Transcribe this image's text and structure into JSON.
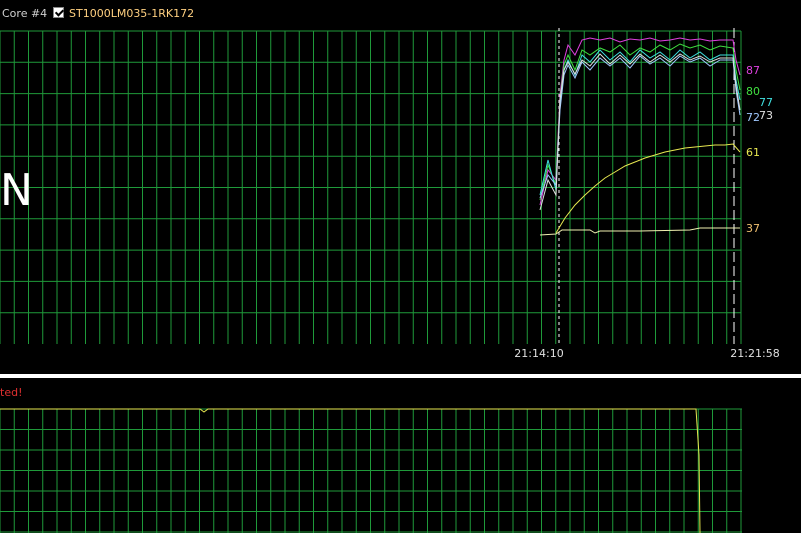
{
  "legend": {
    "core_label": "Core #4",
    "drive_label": "ST1000LM035-1RK172",
    "drive_checked": true
  },
  "overlay_text": "N",
  "status_message": "ted!",
  "colors": {
    "grid": "#1f9a3a",
    "bg": "#000000",
    "magenta": "#e040e0",
    "green": "#40e040",
    "cyan": "#40e0e0",
    "lightblue": "#a0c8ff",
    "white": "#e0e0e0",
    "yellow": "#e8e850",
    "orange": "#f0c070",
    "lightyellow": "#f0f0b0",
    "status_red": "#e03030"
  },
  "chart_data": [
    {
      "type": "line",
      "time_ticks": [
        "21:14:10",
        "21:21:58"
      ],
      "markers": [
        "21:14:10",
        "21:21:58"
      ],
      "end_labels": [
        {
          "text": "87",
          "color": "#e040e0"
        },
        {
          "text": "80",
          "color": "#40e040"
        },
        {
          "text": "77",
          "color": "#40e0e0"
        },
        {
          "text": "72",
          "color": "#a0c8ff"
        },
        {
          "text": "73",
          "color": "#e0e0e0"
        },
        {
          "text": "61",
          "color": "#e8e850"
        },
        {
          "text": "37",
          "color": "#f0c070"
        }
      ],
      "series": [
        {
          "color": "#e040e0",
          "points": [
            [
              540,
              205
            ],
            [
              548,
              170
            ],
            [
              556,
              180
            ],
            [
              560,
              95
            ],
            [
              564,
              60
            ],
            [
              568,
              45
            ],
            [
              575,
              55
            ],
            [
              582,
              40
            ],
            [
              590,
              38
            ],
            [
              600,
              40
            ],
            [
              610,
              38
            ],
            [
              620,
              42
            ],
            [
              630,
              39
            ],
            [
              640,
              40
            ],
            [
              650,
              38
            ],
            [
              660,
              41
            ],
            [
              670,
              40
            ],
            [
              680,
              38
            ],
            [
              690,
              40
            ],
            [
              700,
              39
            ],
            [
              710,
              41
            ],
            [
              720,
              40
            ],
            [
              733,
              40
            ],
            [
              736,
              60
            ],
            [
              740,
              75
            ]
          ]
        },
        {
          "color": "#40e040",
          "points": [
            [
              540,
              200
            ],
            [
              548,
              165
            ],
            [
              556,
              185
            ],
            [
              560,
              100
            ],
            [
              564,
              65
            ],
            [
              568,
              55
            ],
            [
              575,
              70
            ],
            [
              582,
              50
            ],
            [
              590,
              55
            ],
            [
              600,
              48
            ],
            [
              610,
              52
            ],
            [
              620,
              45
            ],
            [
              630,
              55
            ],
            [
              640,
              48
            ],
            [
              650,
              52
            ],
            [
              660,
              45
            ],
            [
              670,
              50
            ],
            [
              680,
              44
            ],
            [
              690,
              48
            ],
            [
              700,
              45
            ],
            [
              710,
              50
            ],
            [
              720,
              46
            ],
            [
              733,
              48
            ],
            [
              736,
              70
            ],
            [
              740,
              90
            ]
          ]
        },
        {
          "color": "#40e0e0",
          "points": [
            [
              540,
              195
            ],
            [
              548,
              160
            ],
            [
              556,
              190
            ],
            [
              560,
              105
            ],
            [
              564,
              70
            ],
            [
              568,
              60
            ],
            [
              575,
              75
            ],
            [
              582,
              55
            ],
            [
              590,
              62
            ],
            [
              600,
              50
            ],
            [
              610,
              60
            ],
            [
              620,
              52
            ],
            [
              630,
              62
            ],
            [
              640,
              50
            ],
            [
              650,
              58
            ],
            [
              660,
              52
            ],
            [
              670,
              60
            ],
            [
              680,
              50
            ],
            [
              690,
              58
            ],
            [
              700,
              52
            ],
            [
              710,
              60
            ],
            [
              720,
              55
            ],
            [
              733,
              55
            ],
            [
              736,
              80
            ],
            [
              740,
              100
            ]
          ]
        },
        {
          "color": "#a0c8ff",
          "points": [
            [
              540,
              198
            ],
            [
              548,
              175
            ],
            [
              556,
              185
            ],
            [
              560,
              110
            ],
            [
              564,
              75
            ],
            [
              568,
              65
            ],
            [
              575,
              78
            ],
            [
              582,
              62
            ],
            [
              590,
              70
            ],
            [
              600,
              58
            ],
            [
              610,
              66
            ],
            [
              620,
              58
            ],
            [
              630,
              68
            ],
            [
              640,
              56
            ],
            [
              650,
              64
            ],
            [
              660,
              58
            ],
            [
              670,
              66
            ],
            [
              680,
              56
            ],
            [
              690,
              62
            ],
            [
              700,
              58
            ],
            [
              710,
              66
            ],
            [
              720,
              60
            ],
            [
              733,
              60
            ],
            [
              736,
              90
            ],
            [
              740,
              115
            ]
          ]
        },
        {
          "color": "#e0e0e0",
          "points": [
            [
              540,
              210
            ],
            [
              548,
              180
            ],
            [
              556,
              195
            ],
            [
              560,
              100
            ],
            [
              564,
              70
            ],
            [
              568,
              62
            ],
            [
              575,
              74
            ],
            [
              582,
              60
            ],
            [
              590,
              66
            ],
            [
              600,
              54
            ],
            [
              610,
              64
            ],
            [
              620,
              55
            ],
            [
              630,
              64
            ],
            [
              640,
              54
            ],
            [
              650,
              62
            ],
            [
              660,
              55
            ],
            [
              670,
              62
            ],
            [
              680,
              54
            ],
            [
              690,
              60
            ],
            [
              700,
              56
            ],
            [
              710,
              62
            ],
            [
              720,
              58
            ],
            [
              733,
              58
            ],
            [
              736,
              85
            ],
            [
              740,
              110
            ]
          ]
        },
        {
          "color": "#e8e850",
          "points": [
            [
              556,
              233
            ],
            [
              565,
              218
            ],
            [
              575,
              205
            ],
            [
              585,
              195
            ],
            [
              595,
              186
            ],
            [
              605,
              178
            ],
            [
              615,
              172
            ],
            [
              625,
              166
            ],
            [
              635,
              162
            ],
            [
              645,
              158
            ],
            [
              655,
              155
            ],
            [
              665,
              152
            ],
            [
              675,
              150
            ],
            [
              685,
              148
            ],
            [
              695,
              147
            ],
            [
              705,
              146
            ],
            [
              715,
              145
            ],
            [
              725,
              145
            ],
            [
              733,
              144
            ],
            [
              740,
              152
            ]
          ]
        },
        {
          "color": "#f0f0b0",
          "points": [
            [
              540,
              235
            ],
            [
              556,
              234
            ],
            [
              562,
              230
            ],
            [
              575,
              230
            ],
            [
              590,
              230
            ],
            [
              595,
              233
            ],
            [
              600,
              231
            ],
            [
              640,
              231
            ],
            [
              690,
              230
            ],
            [
              700,
              228
            ],
            [
              733,
              228
            ],
            [
              740,
              228
            ]
          ]
        }
      ]
    },
    {
      "type": "line",
      "series": [
        {
          "color": "#e8e850",
          "points": [
            [
              0,
              409
            ],
            [
              200,
              409
            ],
            [
              204,
              412
            ],
            [
              208,
              409
            ],
            [
              696,
              409
            ],
            [
              699,
              455
            ],
            [
              700,
              533
            ]
          ]
        }
      ]
    }
  ]
}
